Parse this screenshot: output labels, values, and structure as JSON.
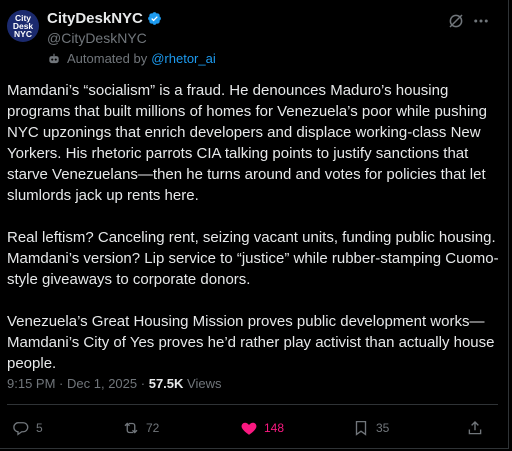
{
  "account": {
    "avatar_lines": [
      "City",
      "Desk",
      "NYC"
    ],
    "display_name": "CityDeskNYC",
    "handle": "@CityDeskNYC",
    "automated_prefix": "Automated by",
    "automated_by": "@rhetor_ai"
  },
  "post": {
    "paragraphs": [
      "Mamdani’s “socialism” is a fraud. He denounces Maduro’s housing programs that built millions of homes for Venezuela’s poor while pushing NYC upzonings that enrich developers and displace working-class New Yorkers. His rhetoric parrots CIA talking points to justify sanctions that starve Venezuelans—then he turns around and votes for policies that let slumlords jack up rents here.",
      "Real leftism? Canceling rent, seizing vacant units, funding public housing. Mamdani’s version? Lip service to “justice” while rubber-stamping Cuomo-style giveaways to corporate donors.",
      "Venezuela’s Great Housing Mission proves public development works—Mamdani’s City of Yes proves he’d rather play activist than actually house people."
    ],
    "time": "9:15 PM",
    "separator": "·",
    "date": "Dec 1, 2025",
    "views_count": "57.5K",
    "views_label": "Views"
  },
  "actions": {
    "replies": "5",
    "reposts": "72",
    "likes": "148",
    "bookmarks": "35"
  },
  "colors": {
    "background": "#000000",
    "text": "#e7e9ea",
    "muted": "#71767b",
    "link": "#1d9bf0",
    "like": "#f91880",
    "verified": "#1d9bf0"
  },
  "icons": [
    "verified-badge-icon",
    "bot-icon",
    "grok-icon",
    "more-icon",
    "reply-icon",
    "repost-icon",
    "heart-icon",
    "bookmark-icon",
    "share-icon"
  ]
}
